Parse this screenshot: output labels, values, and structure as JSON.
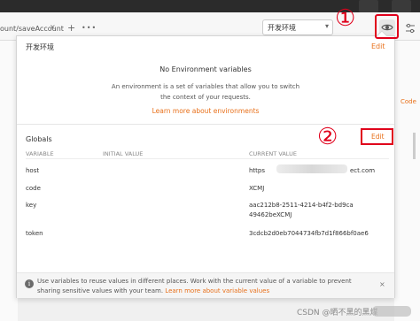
{
  "app": {
    "tab_url": "ount/saveAccount",
    "tab_close_glyph": "×",
    "new_tab_glyph": "+",
    "more_glyph": "•••",
    "environment_selected": "开发环境",
    "dropdown_glyph": "▾",
    "right_side_text": "Code"
  },
  "annotations": {
    "step1": "①",
    "step2": "②"
  },
  "popup": {
    "environment_name": "开发环境",
    "environment_edit_label": "Edit",
    "empty_title": "No Environment variables",
    "empty_description": "An environment is a set of variables that allow you to switch the context of your requests.",
    "learn_more_env": "Learn more about environments",
    "globals_label": "Globals",
    "globals_edit_label": "Edit",
    "columns": [
      "VARIABLE",
      "INITIAL VALUE",
      "CURRENT VALUE"
    ],
    "rows": [
      {
        "variable": "host",
        "initial": "",
        "current_prefix": "https",
        "current_suffix": "ect.com"
      },
      {
        "variable": "code",
        "initial": "",
        "current": "XCMJ"
      },
      {
        "variable": "key",
        "initial": "",
        "current": "aac212b8-2511-4214-b4f2-bd9ca49462beXCMJ"
      },
      {
        "variable": "token",
        "initial": "",
        "current": "3cdcb2d0eb7044734fb7d1f866bf0ae6"
      }
    ],
    "info_text_before": "Use variables to reuse values in different places. Work with the current value of a variable to prevent sharing sensitive values with your team. ",
    "info_link": "Learn more about variable values",
    "info_icon_glyph": "i",
    "info_close_glyph": "×"
  },
  "watermark": "CSDN @晒不黑的黑煤"
}
